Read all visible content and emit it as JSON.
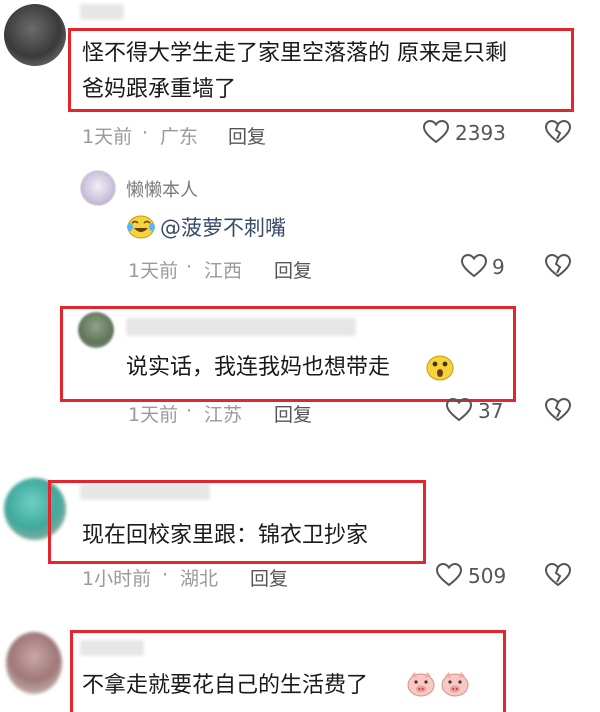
{
  "comments": [
    {
      "text_line1": "怪不得大学生走了家里空落落的 原来是只剩",
      "text_line2": "爸妈跟承重墙了",
      "time": "1天前",
      "location": "广东",
      "reply_label": "回复",
      "likes": "2393"
    },
    {
      "user": "懒懒本人",
      "mention": "@菠萝不刺嘴",
      "time": "1天前",
      "location": "江西",
      "reply_label": "回复",
      "likes": "9"
    },
    {
      "text": "说实话，我连我妈也想带走",
      "time": "1天前",
      "location": "江苏",
      "reply_label": "回复",
      "likes": "37"
    },
    {
      "text": "现在回校家里跟：锦衣卫抄家",
      "time": "1小时前",
      "location": "湖北",
      "reply_label": "回复",
      "likes": "509"
    },
    {
      "text": "不拿走就要花自己的生活费了"
    }
  ],
  "separator": "·",
  "colors": {
    "highlight": "#e4262c",
    "meta": "#9a9a9a",
    "text": "#1a1a1a"
  }
}
